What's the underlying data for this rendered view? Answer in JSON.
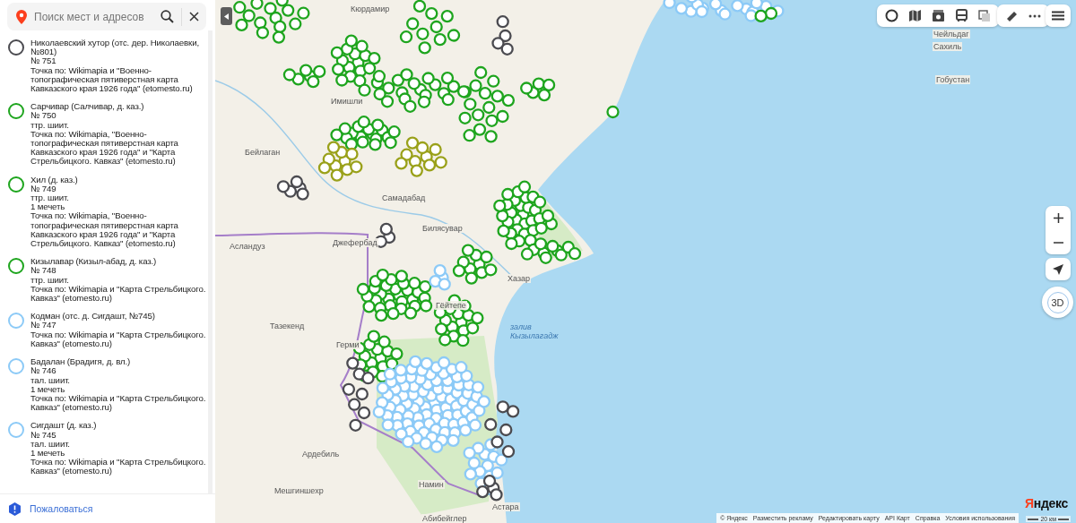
{
  "search": {
    "placeholder": "Поиск мест и адресов"
  },
  "places": [
    {
      "title": "Николаевский хутор (отс. дер. Николаевки, №801)",
      "number": "№ 751",
      "source": "Точка по: Wikimapia и \"Военно-топографическая пятиверстная карта Кавказского края 1926 года\" (etomesto.ru)",
      "color": "#4b4b50"
    },
    {
      "title": "Сарчивар (Салчивар, д. каз.)",
      "number": "№ 750",
      "details": [
        "ттр. шиит."
      ],
      "source": "Точка по: Wikimapia, \"Военно-топографическая пятиверстная карта Кавказского края 1926 года\" и \"Карта Стрельбицкого. Кавказ\" (etomesto.ru)",
      "color": "#1ea51e"
    },
    {
      "title": "Хил (д. каз.)",
      "number": "№ 749",
      "details": [
        "ттр. шиит.",
        "1 мечеть"
      ],
      "source": "Точка по: Wikimapia, \"Военно-топографическая пятиверстная карта Кавказского края 1926 года\" и \"Карта Стрельбицкого. Кавказ\" (etomesto.ru)",
      "color": "#1ea51e"
    },
    {
      "title": "Кизылавар (Кизыл-абад, д. каз.)",
      "number": "№ 748",
      "details": [
        "ттр. шиит."
      ],
      "source": "Точка по: Wikimapia и \"Карта Стрельбицкого. Кавказ\" (etomesto.ru)",
      "color": "#1ea51e"
    },
    {
      "title": "Кодман (отс. д. Сигдашт, №745)",
      "number": "№ 747",
      "source": "Точка по: Wikimapia и \"Карта Стрельбицкого. Кавказ\" (etomesto.ru)",
      "color": "#8ccaf7"
    },
    {
      "title": "Бадалан (Брадигя, д. вл.)",
      "number": "№ 746",
      "details": [
        "тал. шиит.",
        "1 мечеть"
      ],
      "source": "Точка по: Wikimapia и \"Карта Стрельбицкого. Кавказ\" (etomesto.ru)",
      "color": "#8ccaf7"
    },
    {
      "title": "Сигдашт (д. каз.)",
      "number": "№ 745",
      "details": [
        "тал. шиит.",
        "1 мечеть"
      ],
      "source": "Точка по: Wikimapia и \"Карта Стрельбицкого. Кавказ\" (etomesto.ru)",
      "color": "#8ccaf7"
    }
  ],
  "complaint_link": "Пожаловаться",
  "map_labels": [
    "Кюрдамир",
    "Чейльдаг",
    "Сахиль",
    "Гобустан",
    "Имишли",
    "Бейлаган",
    "Самадабад",
    "Джефербад",
    "Билясувар",
    "Асландуз",
    "Хазар",
    "Тазекенд",
    "залив Кызылагадж",
    "Герми",
    "Гёйтепе",
    "Ардебиль",
    "Мешгиншехр",
    "Намин",
    "Астара",
    "Абибейглер"
  ],
  "compass": {
    "label": "3D"
  },
  "logo": "Яндекс",
  "footer_links": [
    "© Яндекс",
    "Разместить рекламу",
    "Редактировать карту",
    "API Карт",
    "Справка",
    "Условия использования"
  ],
  "scale": "20 км"
}
